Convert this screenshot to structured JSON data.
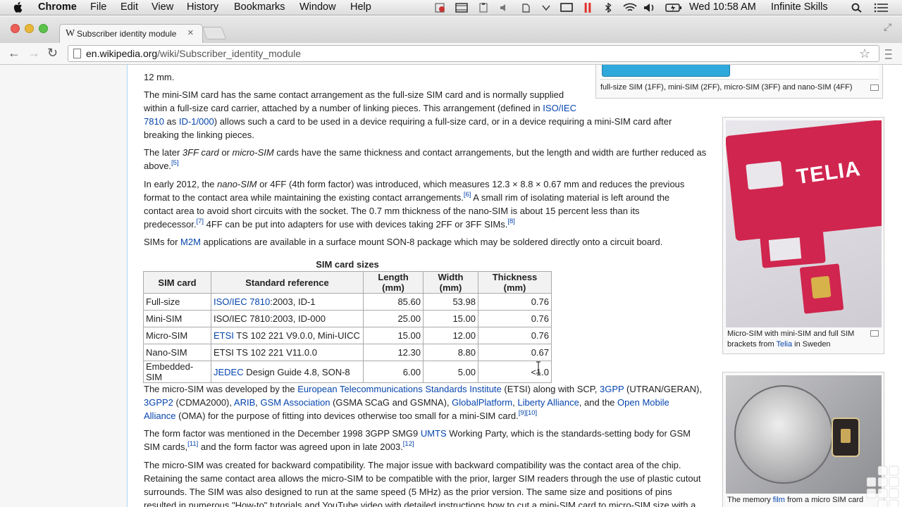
{
  "menubar": {
    "app_name": "Chrome",
    "items": [
      "File",
      "Edit",
      "View",
      "History",
      "Bookmarks",
      "Window",
      "Help"
    ],
    "clock": "Wed 10:58 AM",
    "user": "Infinite Skills"
  },
  "browser": {
    "tab_title": "Subscriber identity module",
    "tab_favicon": "W",
    "url_host": "en.wikipedia.org",
    "url_path": "/wiki/Subscriber_identity_module"
  },
  "article": {
    "p0_tail": "12 mm.",
    "p1": {
      "a": "The mini-SIM card has the same contact arrangement as the full-size SIM card and is normally supplied",
      "b": "within a full-size card carrier, attached by a number of linking pieces. This arrangement (defined in ",
      "link1": "ISO/IEC",
      "link1b": "7810",
      "c": " as ",
      "link2": "ID-1/000",
      "d": ") allows such a card to be used in a device requiring a full-size card, or in a device requiring a mini-SIM card after",
      "e": "breaking the linking pieces."
    },
    "p2": {
      "a": "The later ",
      "em1": "3FF card",
      "b": " or ",
      "em2": "micro-SIM",
      "c": " cards have the same thickness and contact arrangements, but the length and width are further reduced as",
      "d": "above.",
      "ref": "[5]"
    },
    "p3": {
      "a": "In early 2012, the ",
      "em1": "nano-SIM",
      "b": " or 4FF (4th form factor) was introduced, which measures 12.3 × 8.8 × 0.67 mm and reduces the previous",
      "c": "format to the contact area while maintaining the existing contact arrangements.",
      "ref1": "[6]",
      "d": " A small rim of isolating material is left around the",
      "e": "contact area to avoid short circuits with the socket. The 0.7 mm thickness of the nano-SIM is about 15 percent less than its",
      "f": "predecessor.",
      "ref2": "[7]",
      "g": " 4FF can be put into adapters for use with devices taking 2FF or 3FF SIMs.",
      "ref3": "[8]"
    },
    "p4": {
      "a": "SIMs for ",
      "link": "M2M",
      "b": " applications are available in a surface mount SON-8 package which may be soldered directly onto a circuit board."
    },
    "table": {
      "caption": "SIM card sizes",
      "headers": [
        "SIM card",
        "Standard reference",
        "Length (mm)",
        "Width (mm)",
        "Thickness (mm)"
      ],
      "rows": [
        {
          "card": "Full-size",
          "ref_link": "ISO/IEC 7810",
          "ref_rest": ":2003, ID-1",
          "length": "85.60",
          "width": "53.98",
          "thickness": "0.76"
        },
        {
          "card": "Mini-SIM",
          "ref_link": "",
          "ref_rest": "ISO/IEC 7810:2003, ID-000",
          "length": "25.00",
          "width": "15.00",
          "thickness": "0.76"
        },
        {
          "card": "Micro-SIM",
          "ref_link": "ETSI",
          "ref_rest": " TS 102 221 V9.0.0, Mini-UICC",
          "length": "15.00",
          "width": "12.00",
          "thickness": "0.76"
        },
        {
          "card": "Nano-SIM",
          "ref_link": "",
          "ref_rest": "ETSI TS 102 221 V11.0.0",
          "length": "12.30",
          "width": "8.80",
          "thickness": "0.67"
        },
        {
          "card": "Embedded-SIM",
          "ref_link": "JEDEC",
          "ref_rest": " Design Guide 4.8, SON-8",
          "length": "6.00",
          "width": "5.00",
          "thickness": "<1.0"
        }
      ]
    },
    "p5": {
      "a": "The micro-SIM was developed by the ",
      "l1": "European Telecommunications Standards Institute",
      "b": " (ETSI) along with SCP, ",
      "l2": "3GPP",
      "c": " (UTRAN/GERAN),",
      "l3": "3GPP2",
      "d": " (CDMA2000), ",
      "l4": "ARIB",
      "e": ", ",
      "l5": "GSM Association",
      "f": " (GSMA SCaG and GSMNA), ",
      "l6": "GlobalPlatform",
      "g": ", ",
      "l7": "Liberty Alliance",
      "h": ", and the ",
      "l8": "Open Mobile",
      "l8b": "Alliance",
      "i": " (OMA) for the purpose of fitting into devices otherwise too small for a mini-SIM card.",
      "ref": "[9][10]"
    },
    "p6": {
      "a": "The form factor was mentioned in the December 1998 3GPP SMG9 ",
      "link": "UMTS",
      "b": " Working Party, which is the standards-setting body for GSM",
      "c": "SIM cards,",
      "ref1": "[11]",
      "d": " and the form factor was agreed upon in late 2003.",
      "ref2": "[12]"
    },
    "p7": {
      "a": "The micro-SIM was created for backward compatibility. The major issue with backward compatibility was the contact area of the chip.",
      "b": "Retaining the same contact area allows the micro-SIM to be compatible with the prior, larger SIM readers through the use of plastic cutout",
      "c": "surrounds. The SIM was also designed to run at the same speed (5 MHz) as the prior version. The same size and positions of pins",
      "d": "resulted in numerous \"How-to\" tutorials and YouTube video with detailed instructions how to cut a mini-SIM card to micro-SIM size with a"
    }
  },
  "thumbs": {
    "t1_caption": "full-size SIM (1FF), mini-SIM (2FF), micro-SIM (3FF) and nano-SIM (4FF)",
    "t2_caption_a": "Micro-SIM with mini-SIM and full SIM",
    "t2_caption_b": "brackets from ",
    "t2_caption_link": "Telia",
    "t2_caption_c": " in Sweden",
    "t2_card_text": "TELIA",
    "t3_caption_a": "The memory ",
    "t3_caption_link": "film",
    "t3_caption_b": " from a micro SIM card"
  },
  "colors": {
    "link": "#0645ad",
    "telia_red": "#d0254e"
  }
}
